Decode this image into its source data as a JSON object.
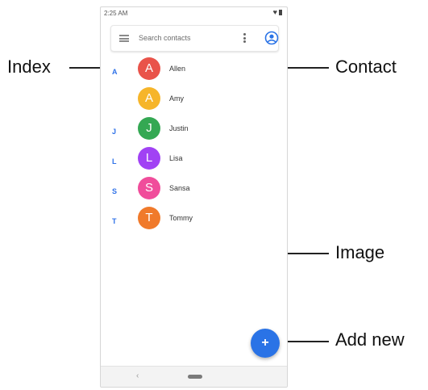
{
  "status_bar": {
    "time": "2:25 AM"
  },
  "search": {
    "placeholder": "Search contacts"
  },
  "contacts": [
    {
      "index_letter": "A",
      "initial": "A",
      "name": "Allen",
      "color": "#e9534a"
    },
    {
      "index_letter": "",
      "initial": "A",
      "name": "Amy",
      "color": "#f6b52a"
    },
    {
      "index_letter": "J",
      "initial": "J",
      "name": "Justin",
      "color": "#34a853"
    },
    {
      "index_letter": "L",
      "initial": "L",
      "name": "Lisa",
      "color": "#a142f4"
    },
    {
      "index_letter": "S",
      "initial": "S",
      "name": "Sansa",
      "color": "#f04d9b"
    },
    {
      "index_letter": "T",
      "initial": "T",
      "name": "Tommy",
      "color": "#f07a2b"
    }
  ],
  "fab": {
    "symbol": "+"
  },
  "navigation": {
    "back_symbol": "‹"
  },
  "callouts": {
    "index": "Index",
    "contact": "Contact",
    "image": "Image",
    "add_new": "Add new"
  },
  "colors": {
    "accent": "#2a73e6",
    "index_letter": "#2f72e8"
  }
}
